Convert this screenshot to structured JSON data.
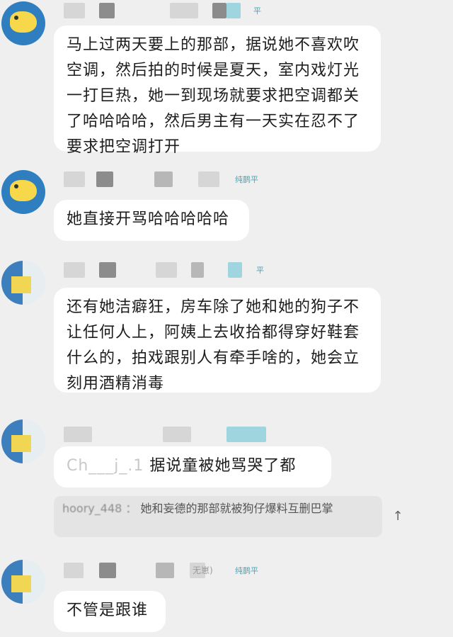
{
  "messages": [
    {
      "tag": "平",
      "faint": "",
      "text": "马上过两天要上的那部，据说她不喜欢吹空调，然后拍的时候是夏天，室内戏灯光一打巨热，她一到现场就要求把空调都关了哈哈哈哈，然后男主有一天实在忍不了要求把空调打开"
    },
    {
      "tag": "纯鹊平",
      "faint": "",
      "text": "她直接开骂哈哈哈哈哈"
    },
    {
      "tag": "平",
      "faint": "",
      "text": "还有她洁癖狂，房车除了她和她的狗子不让任何人上，阿姨上去收拾都得穿好鞋套什么的，拍戏跟别人有牵手啥的，她会立刻用酒精消毒"
    },
    {
      "tag": "",
      "faint": "",
      "reply_prefix": "Ch___j_.1 ",
      "text": "据说童被她骂哭了都",
      "quote": {
        "prefix": "hoory_448 ：  ",
        "text": "她和妄德的那部就被狗仔爆料互删巴掌"
      }
    },
    {
      "tag": "纯鹊平",
      "faint": "无崽)",
      "text": "不管是跟谁"
    }
  ],
  "icons": {
    "quote_arrow": "↑"
  }
}
